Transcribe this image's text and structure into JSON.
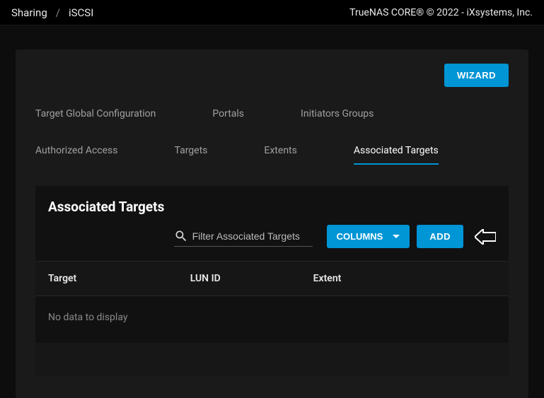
{
  "breadcrumb": {
    "root": "Sharing",
    "sep": "/",
    "current": "iSCSI"
  },
  "copyright": "TrueNAS CORE® © 2022 - iXsystems, Inc.",
  "wizard_label": "WIZARD",
  "tabs_row1": [
    {
      "label": "Target Global Configuration"
    },
    {
      "label": "Portals"
    },
    {
      "label": "Initiators Groups"
    }
  ],
  "tabs_row2": [
    {
      "label": "Authorized Access"
    },
    {
      "label": "Targets"
    },
    {
      "label": "Extents"
    },
    {
      "label": "Associated Targets",
      "active": true
    }
  ],
  "panel": {
    "title": "Associated Targets",
    "search_placeholder": "Filter Associated Targets",
    "columns_label": "COLUMNS",
    "add_label": "ADD",
    "columns": [
      "Target",
      "LUN ID",
      "Extent"
    ],
    "empty": "No data to display",
    "rows": []
  },
  "colors": {
    "accent": "#0095d5"
  }
}
